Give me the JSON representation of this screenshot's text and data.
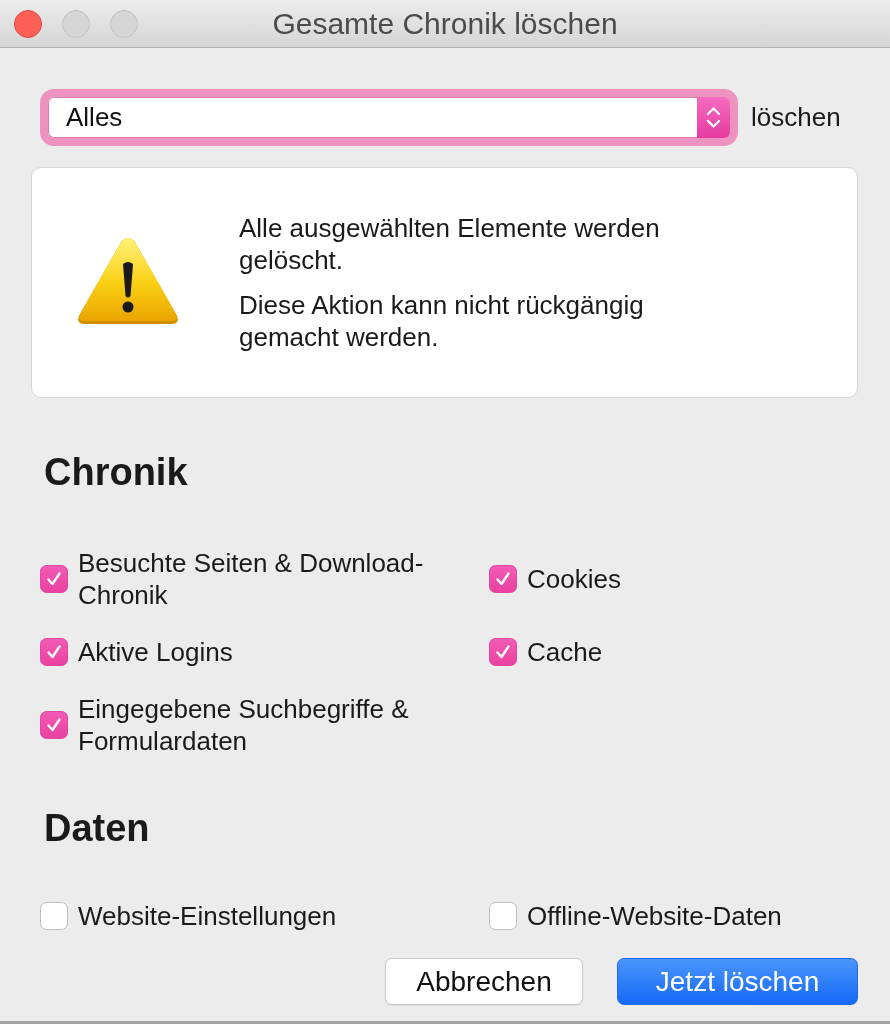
{
  "window": {
    "title": "Gesamte Chronik löschen",
    "controls": [
      {
        "kind": "close",
        "disabled": false
      },
      {
        "kind": "minimize",
        "disabled": true
      },
      {
        "kind": "zoom",
        "disabled": true
      }
    ]
  },
  "range": {
    "value": "Alles",
    "focused": true,
    "label": "löschen"
  },
  "warning": {
    "paragraphs": [
      "Alle ausgewählten Elemente werden gelöscht.",
      "Diese Aktion kann nicht rückgängig gemacht werden."
    ]
  },
  "sections": [
    {
      "heading": "Chronik",
      "options": [
        {
          "label": "Besuchte Seiten & Download-Chronik",
          "checked": true
        },
        {
          "label": "Cookies",
          "checked": true
        },
        {
          "label": "Aktive Logins",
          "checked": true
        },
        {
          "label": "Cache",
          "checked": true
        },
        {
          "label": "Eingegebene Suchbegriffe & Formulardaten",
          "checked": true
        }
      ]
    },
    {
      "heading": "Daten",
      "options": [
        {
          "label": "Website-Einstellungen",
          "checked": false
        },
        {
          "label": "Offline-Website-Daten",
          "checked": false
        }
      ]
    }
  ],
  "buttons": [
    {
      "label": "Abbrechen",
      "kind": "cancel"
    },
    {
      "label": "Jetzt löschen",
      "kind": "confirm"
    }
  ]
}
